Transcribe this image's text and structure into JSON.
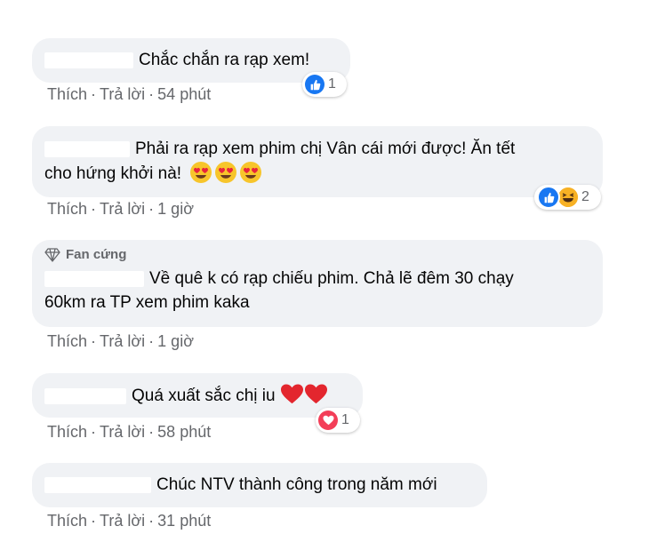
{
  "colors": {
    "bubble": "#f0f2f5",
    "meta_text": "#65676b",
    "like_blue": "#1877f2",
    "love_red": "#f33e58",
    "haha_yellow": "#f7b125"
  },
  "comments": [
    {
      "text": "Chắc chắn ra rạp xem!",
      "actions": {
        "like": "Thích",
        "reply": "Trả lời",
        "time": "54 phút"
      },
      "reactions": {
        "icons": [
          "like-icon"
        ],
        "count": "1"
      }
    },
    {
      "text_line1": "Phải ra rạp xem phim chị Vân cái mới được! Ăn tết",
      "text_line2": "cho hứng khởi nà!",
      "emoji": [
        "heart-eyes-icon",
        "heart-eyes-icon",
        "heart-eyes-icon"
      ],
      "actions": {
        "like": "Thích",
        "reply": "Trả lời",
        "time": "1 giờ"
      },
      "reactions": {
        "icons": [
          "like-icon",
          "haha-icon"
        ],
        "count": "2"
      }
    },
    {
      "badge": "Fan cứng",
      "text_line1": "Về quê k có rạp chiếu phim. Chả lẽ đêm 30 chạy",
      "text_line2": "60km ra TP xem phim kaka",
      "actions": {
        "like": "Thích",
        "reply": "Trả lời",
        "time": "1 giờ"
      }
    },
    {
      "text": "Quá xuất sắc chị iu",
      "emoji": [
        "red-heart-icon",
        "red-heart-icon"
      ],
      "actions": {
        "like": "Thích",
        "reply": "Trả lời",
        "time": "58 phút"
      },
      "reactions": {
        "icons": [
          "love-icon"
        ],
        "count": "1"
      }
    },
    {
      "text": "Chúc NTV thành công trong năm mới",
      "actions": {
        "like": "Thích",
        "reply": "Trả lời",
        "time": "31 phút"
      }
    }
  ]
}
